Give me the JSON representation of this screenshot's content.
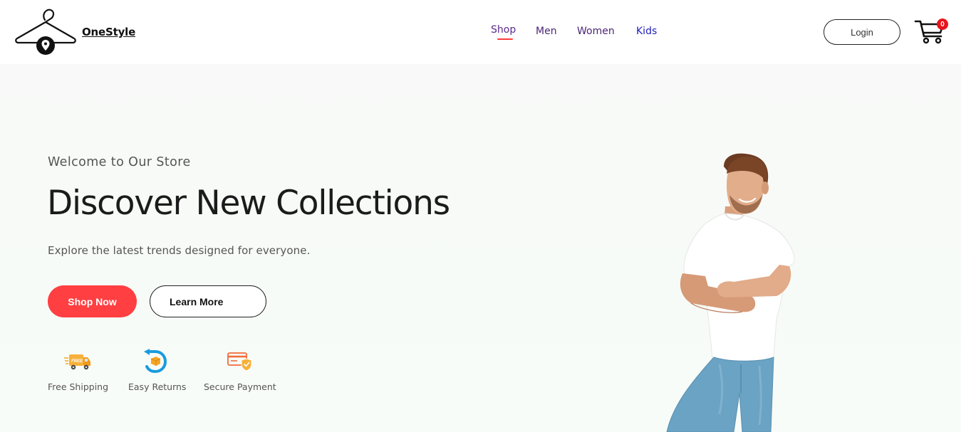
{
  "brand": {
    "name": "OneStyle",
    "logo_icon": "hanger-location-icon"
  },
  "nav": {
    "items": [
      {
        "label": "Shop",
        "active": true
      },
      {
        "label": "Men",
        "active": false
      },
      {
        "label": "Women",
        "active": false
      },
      {
        "label": "Kids",
        "active": false
      }
    ]
  },
  "header": {
    "login_label": "Login",
    "cart_icon": "shopping-cart-icon",
    "cart_count": "0"
  },
  "hero": {
    "welcome": "Welcome to Our Store",
    "headline": "Discover New Collections",
    "subtitle": "Explore the latest trends designed for everyone.",
    "primary_button": "Shop Now",
    "secondary_button": "Learn More",
    "image": "male-model-white-tshirt"
  },
  "features": [
    {
      "label": "Free Shipping",
      "icon": "delivery-truck-icon"
    },
    {
      "label": "Easy Returns",
      "icon": "return-arrow-icon"
    },
    {
      "label": "Secure Payment",
      "icon": "secure-card-icon"
    }
  ],
  "colors": {
    "accent": "#ff3f42",
    "nav_active_underline": "#ff3b3b",
    "hero_background": "#f8fbf8",
    "cart_badge": "#e8141a"
  }
}
